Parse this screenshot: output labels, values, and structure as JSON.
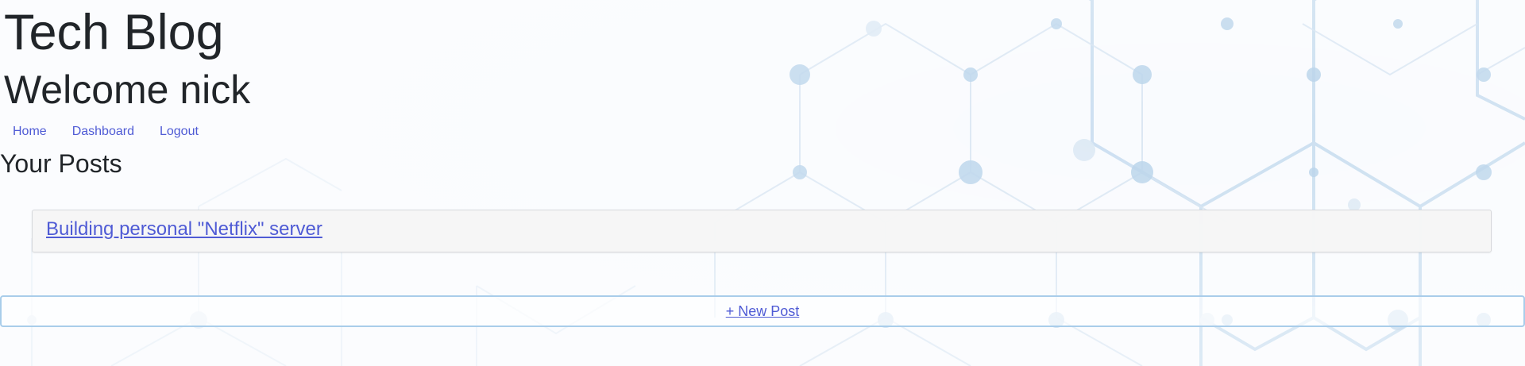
{
  "header": {
    "site_title": "Tech Blog",
    "welcome": "Welcome nick"
  },
  "nav": {
    "items": [
      {
        "label": "Home"
      },
      {
        "label": "Dashboard"
      },
      {
        "label": "Logout"
      }
    ]
  },
  "dashboard": {
    "section_title": "Your Posts",
    "posts": [
      {
        "title": "Building personal \"Netflix\" server"
      }
    ],
    "new_post_label": "+ New Post"
  },
  "colors": {
    "link": "#4f5bd5",
    "text": "#212529",
    "background_pattern": "#a9cdea"
  }
}
